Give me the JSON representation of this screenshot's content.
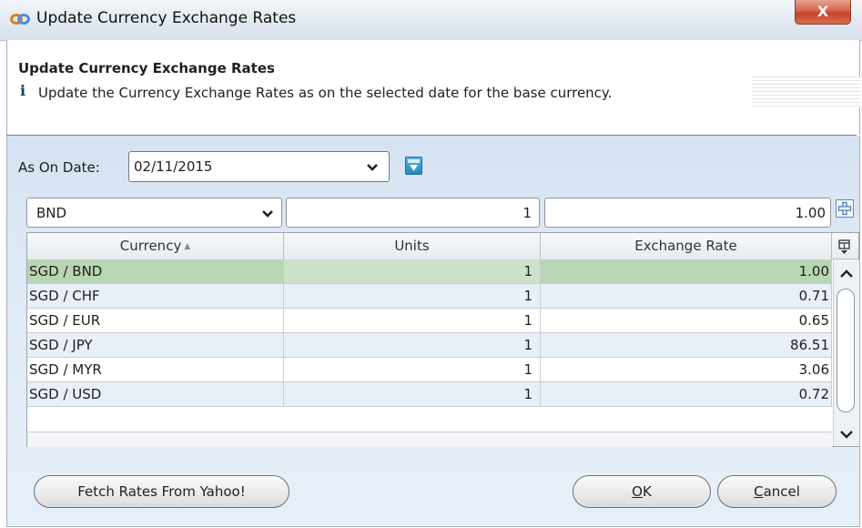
{
  "window": {
    "title": "Update Currency Exchange Rates",
    "close_label": "X"
  },
  "header": {
    "title": "Update Currency Exchange Rates",
    "info_glyph": "i",
    "description": "Update the Currency Exchange Rates as on the selected date for the base currency."
  },
  "date_filter": {
    "label": "As On Date:",
    "value": "02/11/2015",
    "export_icon": "csv-export-icon"
  },
  "new_entry": {
    "currency": "BND",
    "units": "1",
    "rate": "1.00",
    "add_icon": "plus-icon"
  },
  "grid": {
    "columns": [
      "Currency",
      "Units",
      "Exchange Rate"
    ],
    "sort_column": "Currency",
    "sort_glyph": "▲",
    "rows": [
      {
        "currency": "SGD / BND",
        "units": "1",
        "rate": "1.00"
      },
      {
        "currency": "SGD / CHF",
        "units": "1",
        "rate": "0.71"
      },
      {
        "currency": "SGD / EUR",
        "units": "1",
        "rate": "0.65"
      },
      {
        "currency": "SGD / JPY",
        "units": "1",
        "rate": "86.51"
      },
      {
        "currency": "SGD / MYR",
        "units": "1",
        "rate": "3.06"
      },
      {
        "currency": "SGD / USD",
        "units": "1",
        "rate": "0.72"
      }
    ],
    "selected_row": 0,
    "column_chooser_icon": "column-chooser-icon"
  },
  "buttons": {
    "fetch": "Fetch Rates From Yahoo!",
    "ok_mnemonic": "O",
    "ok_rest": "K",
    "cancel_mnemonic": "C",
    "cancel_rest": "ancel"
  },
  "colors": {
    "selected_row": "#b9d5b4",
    "alt_row": "#e9eff6",
    "panel_background": "#dfe9f5",
    "close_button": "#c34328"
  }
}
